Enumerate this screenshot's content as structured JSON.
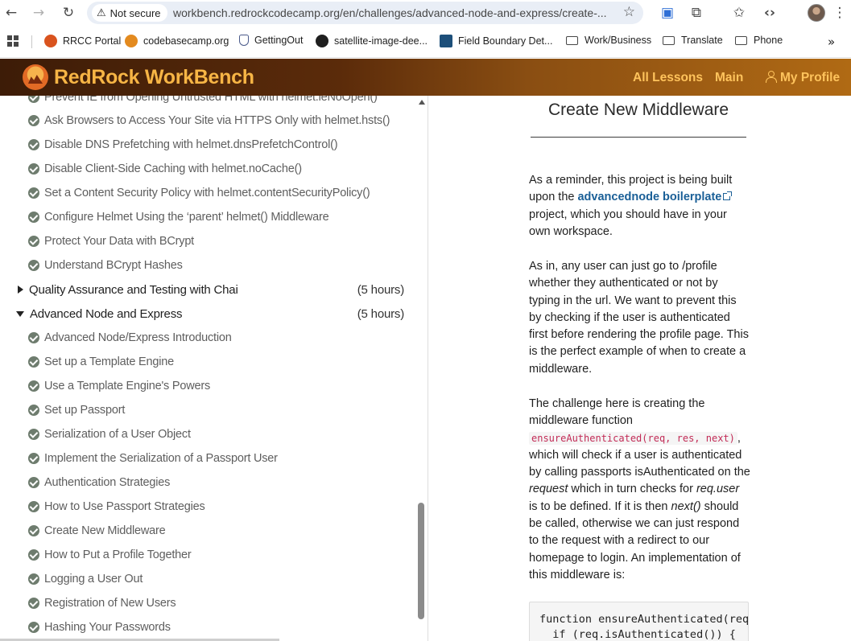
{
  "browser": {
    "security_label": "Not secure",
    "url": "workbench.redrockcodecamp.org/en/challenges/advanced-node-and-express/create-...",
    "bookmarks": [
      {
        "label": "RRCC Portal",
        "icon": "rrcc-icon"
      },
      {
        "label": "codebasecamp.org",
        "icon": "codebasecamp-icon"
      },
      {
        "label": "GettingOut",
        "icon": "shield-icon"
      },
      {
        "label": "satellite-image-dee...",
        "icon": "github-icon"
      },
      {
        "label": "Field Boundary Det...",
        "icon": "tds-icon"
      },
      {
        "label": "Work/Business",
        "icon": "folder-icon"
      },
      {
        "label": "Translate",
        "icon": "folder-icon"
      },
      {
        "label": "Phone",
        "icon": "folder-icon"
      }
    ]
  },
  "site": {
    "logo_text": "RedRock WorkBench",
    "nav": {
      "all_lessons": "All Lessons",
      "main": "Main",
      "profile": "My Profile"
    }
  },
  "lessons_top": [
    "Prevent IE from Opening Untrusted HTML with helmet.ieNoOpen()",
    "Ask Browsers to Access Your Site via HTTPS Only with helmet.hsts()",
    "Disable DNS Prefetching with helmet.dnsPrefetchControl()",
    "Disable Client-Side Caching with helmet.noCache()",
    "Set a Content Security Policy with helmet.contentSecurityPolicy()",
    "Configure Helmet Using the ‘parent’ helmet() Middleware",
    "Protect Your Data with BCrypt",
    "Understand BCrypt Hashes"
  ],
  "sections": [
    {
      "title": "Quality Assurance and Testing with Chai",
      "hours": "(5 hours)",
      "expanded": false
    },
    {
      "title": "Advanced Node and Express",
      "hours": "(5 hours)",
      "expanded": true
    }
  ],
  "lessons_advanced": [
    "Advanced Node/Express Introduction",
    "Set up a Template Engine",
    "Use a Template Engine's Powers",
    "Set up Passport",
    "Serialization of a User Object",
    "Implement the Serialization of a Passport User",
    "Authentication Strategies",
    "How to Use Passport Strategies",
    "Create New Middleware",
    "How to Put a Profile Together",
    "Logging a User Out",
    "Registration of New Users",
    "Hashing Your Passwords"
  ],
  "challenge": {
    "title": "Create New Middleware",
    "p1_before": "As a reminder, this project is being built upon the ",
    "p1_link": "advancednode boilerplate",
    "p1_after": " project, which you should have in your own workspace.",
    "p2": "As in, any user can just go to /profile whether they authenticated or not by typing in the url. We want to prevent this by checking if the user is authenticated first before rendering the profile page. This is the perfect example of when to create a middleware.",
    "p3_a": "The challenge here is creating the middleware function ",
    "p3_code": "ensureAuthenticated(req, res, next)",
    "p3_b": ", which will check if a user is authenticated by calling passports isAuthenticated on the ",
    "p3_em1": "request",
    "p3_c": " which in turn checks for ",
    "p3_em2": "req.user",
    "p3_d": " is to be defined. If it is then ",
    "p3_em3": "next()",
    "p3_e": " should be called, otherwise we can just respond to the request with a redirect to our homepage to login. An implementation of this middleware is:",
    "code": "function ensureAuthenticated(req, res, next) {\n  if (req.isAuthenticated()) {"
  }
}
